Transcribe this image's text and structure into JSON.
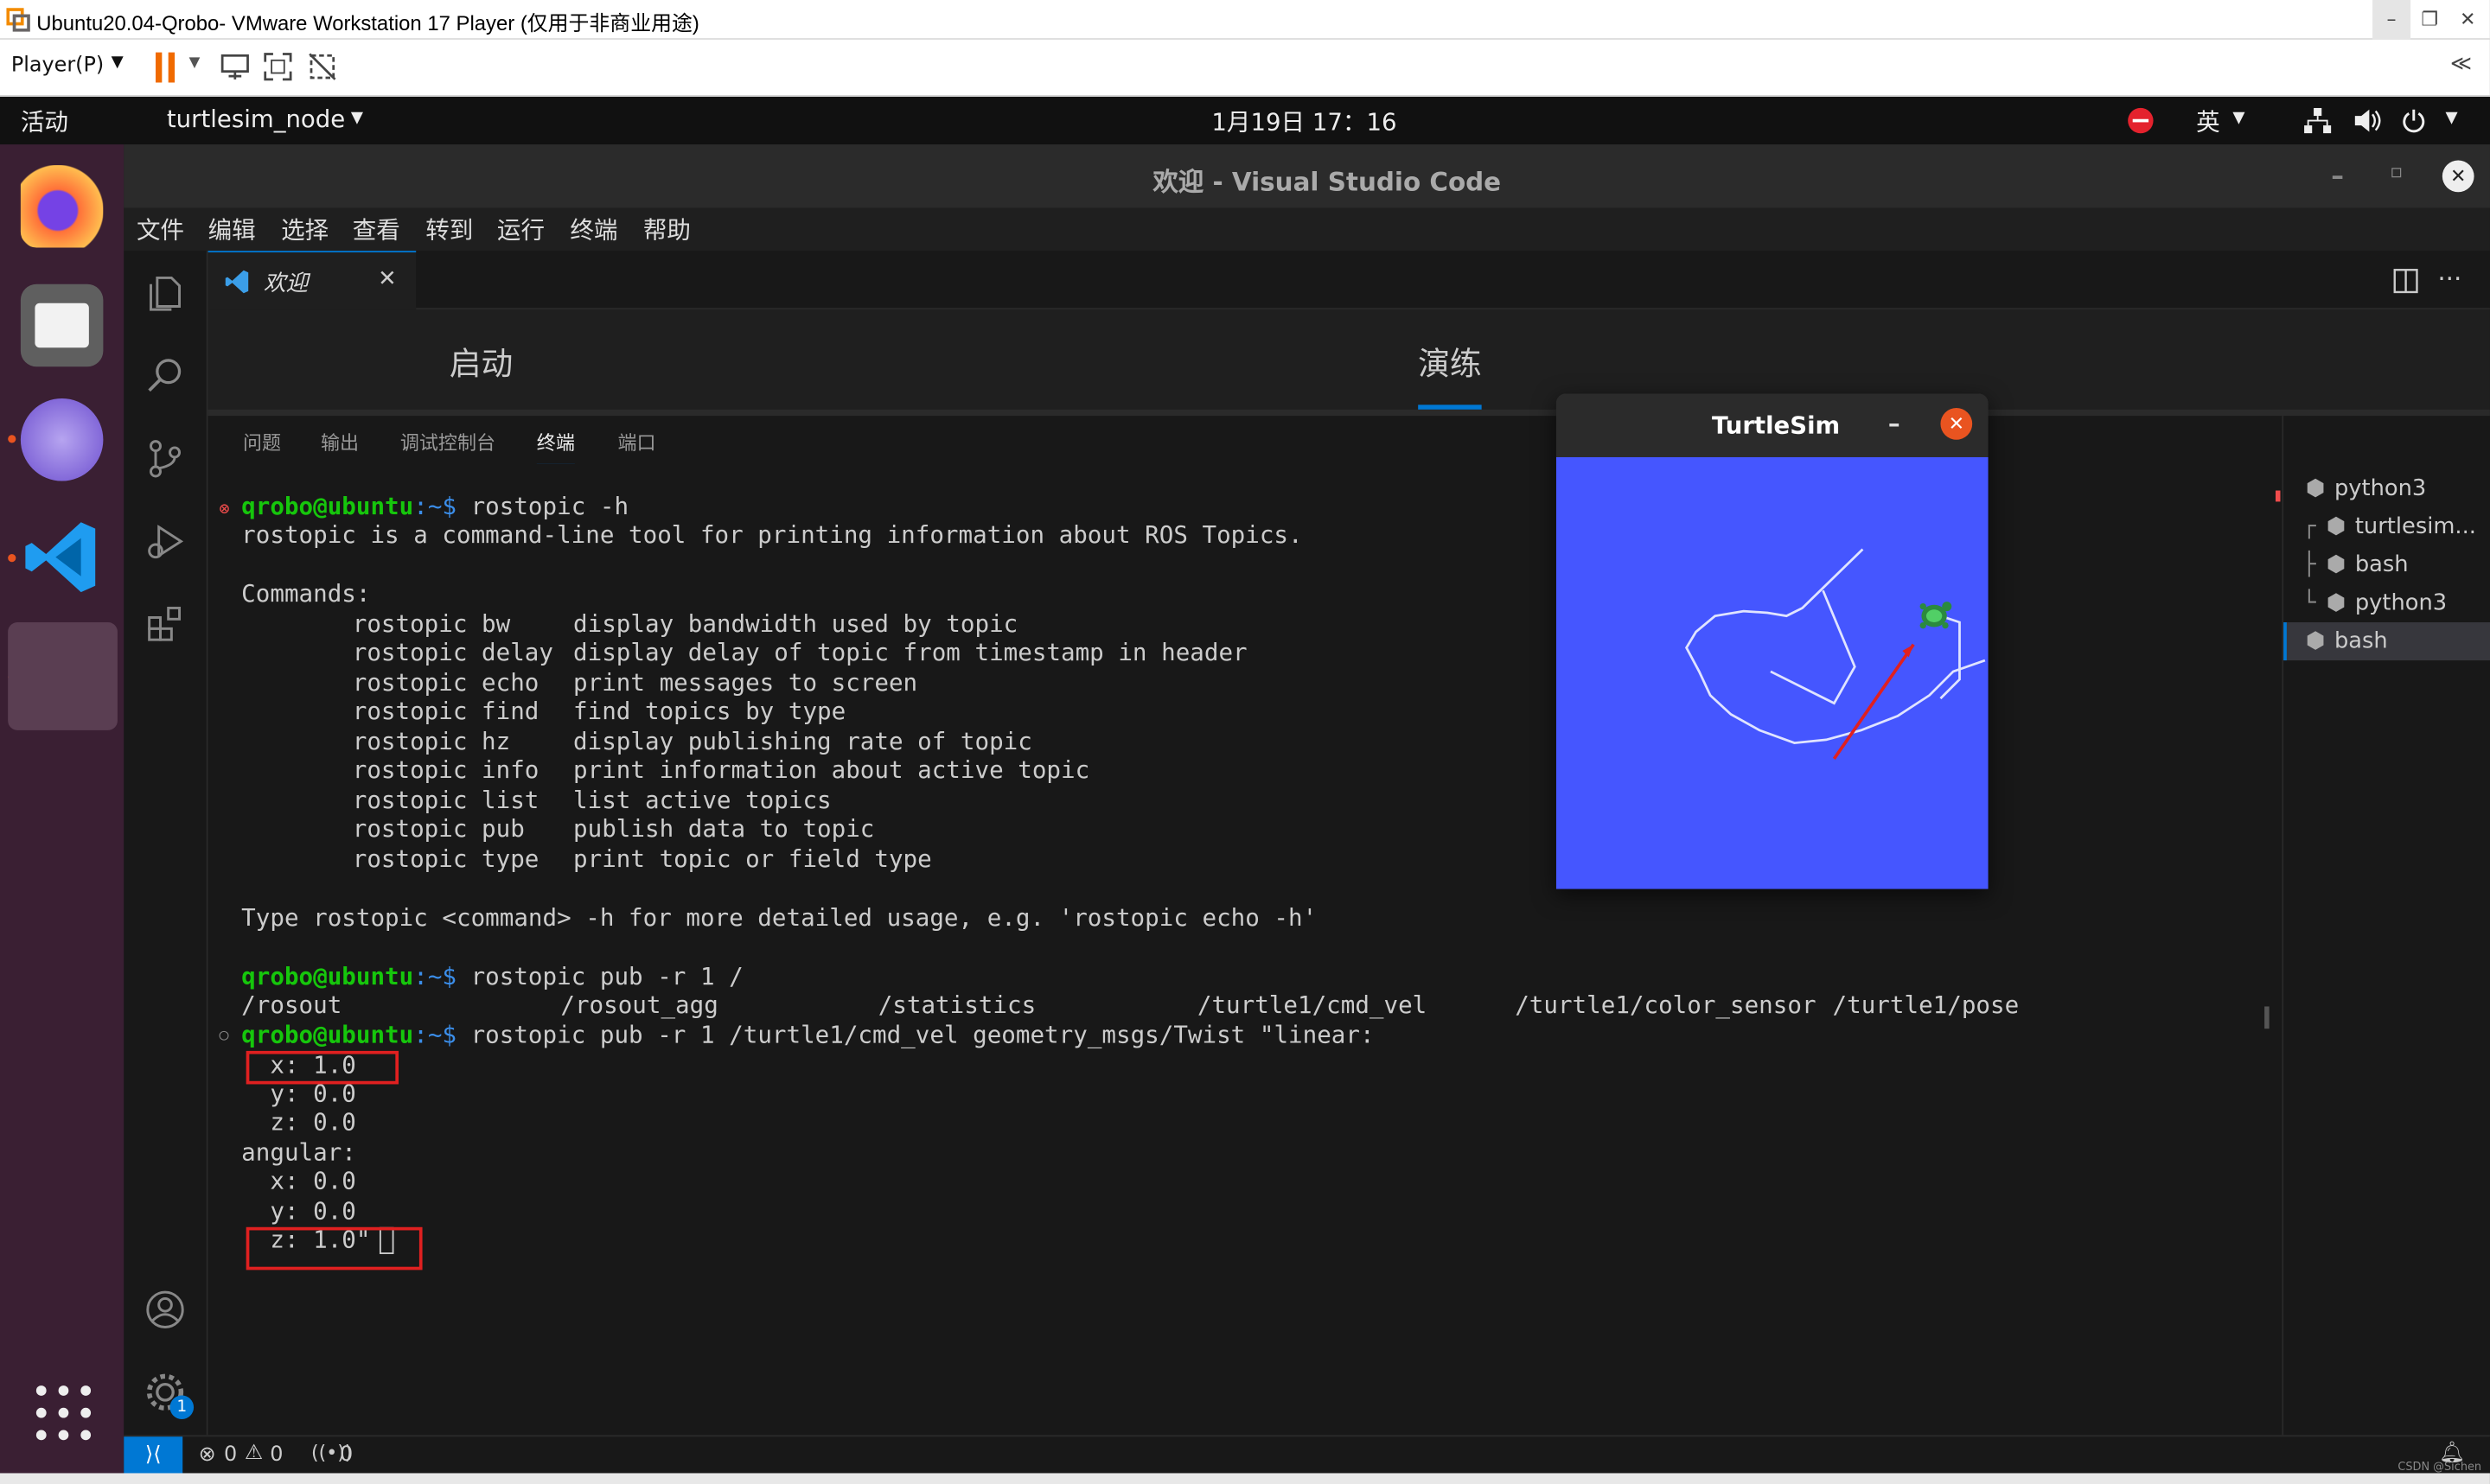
{
  "vmware": {
    "title": "Ubuntu20.04-Qrobo- VMware Workstation 17 Player (仅用于非商业用途)",
    "player_menu": "Player(P)",
    "collapse": "≪"
  },
  "ubuntu_bar": {
    "activities": "活动",
    "app_menu": "turtlesim_node",
    "clock": "1月19日 17：16",
    "input_method": "英"
  },
  "vscode": {
    "window_title": "欢迎 - Visual Studio Code",
    "menu": [
      "文件",
      "编辑",
      "选择",
      "查看",
      "转到",
      "运行",
      "终端",
      "帮助"
    ],
    "tab_label": "欢迎",
    "welcome": {
      "start_heading": "启动",
      "walkthrough_heading": "演练"
    },
    "panel_tabs": [
      "问题",
      "输出",
      "调试控制台",
      "终端",
      "端口"
    ],
    "active_panel_tab": "终端",
    "terminal": {
      "user_host": "qrobo@ubuntu",
      "path_prompt": ":~$",
      "cmd1": " rostopic -h",
      "help_line": "rostopic is a command-line tool for printing information about ROS Topics.",
      "commands_header": "Commands:",
      "commands": [
        {
          "name": "rostopic bw",
          "desc": "display bandwidth used by topic"
        },
        {
          "name": "rostopic delay",
          "desc": "display delay of topic from timestamp in header"
        },
        {
          "name": "rostopic echo",
          "desc": "print messages to screen"
        },
        {
          "name": "rostopic find",
          "desc": "find topics by type"
        },
        {
          "name": "rostopic hz",
          "desc": "display publishing rate of topic"
        },
        {
          "name": "rostopic info",
          "desc": "print information about active topic"
        },
        {
          "name": "rostopic list",
          "desc": "list active topics"
        },
        {
          "name": "rostopic pub",
          "desc": "publish data to topic"
        },
        {
          "name": "rostopic type",
          "desc": "print topic or field type"
        }
      ],
      "usage_line": "Type rostopic <command> -h for more detailed usage, e.g. 'rostopic echo -h'",
      "cmd2": " rostopic pub -r 1 /",
      "topics": [
        "/rosout",
        "/rosout_agg",
        "/statistics",
        "/turtle1/cmd_vel",
        "/turtle1/color_sensor",
        "/turtle1/pose"
      ],
      "cmd3": " rostopic pub -r 1 /turtle1/cmd_vel geometry_msgs/Twist \"linear:",
      "msg_lines": [
        "  x: 1.0",
        "  y: 0.0",
        "  z: 0.0",
        "angular:",
        "  x: 0.0",
        "  y: 0.0",
        "  z: 1.0\""
      ]
    },
    "terminal_list": [
      "python3",
      "turtlesim...",
      "bash",
      "python3",
      "bash"
    ],
    "status": {
      "errors": "0",
      "warnings": "0",
      "ports": "0"
    },
    "settings_badge": "1"
  },
  "turtlesim": {
    "title": "TurtleSim",
    "background": "#4556ff"
  },
  "watermark": "CSDN @Sichen"
}
